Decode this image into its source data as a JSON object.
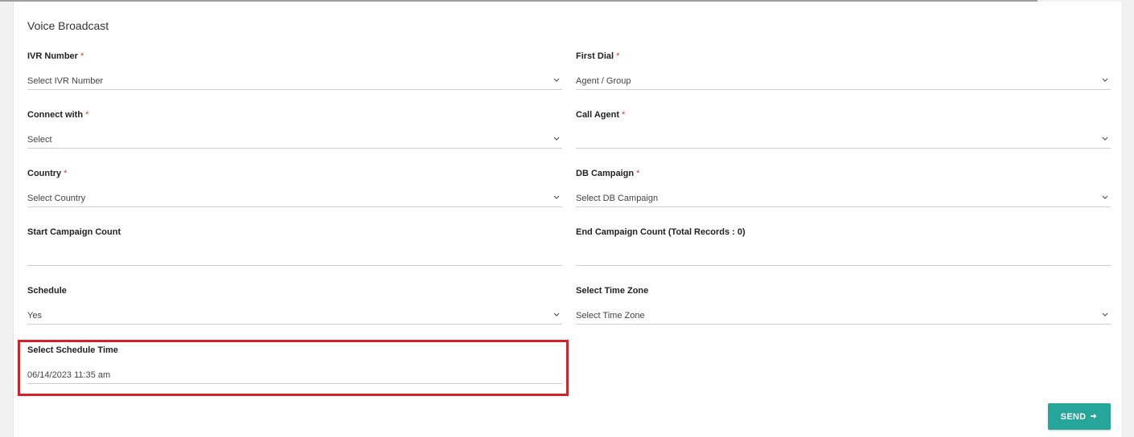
{
  "form": {
    "title": "Voice Broadcast",
    "required_mark": "*",
    "fields": {
      "ivr_number": {
        "label": "IVR Number",
        "value": "Select IVR Number"
      },
      "first_dial": {
        "label": "First Dial",
        "value": "Agent / Group"
      },
      "connect_with": {
        "label": "Connect with",
        "value": "Select"
      },
      "call_agent": {
        "label": "Call Agent",
        "value": ""
      },
      "country": {
        "label": "Country",
        "value": "Select Country"
      },
      "db_campaign": {
        "label": "DB Campaign",
        "value": "Select DB Campaign"
      },
      "start_campaign_count": {
        "label": "Start Campaign Count",
        "value": ""
      },
      "end_campaign_count": {
        "label": "End Campaign Count (Total Records : 0)",
        "value": ""
      },
      "schedule": {
        "label": "Schedule",
        "value": "Yes"
      },
      "select_time_zone": {
        "label": "Select Time Zone",
        "value": "Select Time Zone"
      },
      "select_schedule_time": {
        "label": "Select Schedule Time",
        "value": "06/14/2023 11:35 am"
      }
    },
    "send_label": "SEND"
  },
  "colors": {
    "accent": "#26a69a",
    "required": "#e53935",
    "highlight": "#d3222a"
  },
  "icons": {
    "dropdown": "chevron-down-icon",
    "send": "arrow-right-icon"
  }
}
